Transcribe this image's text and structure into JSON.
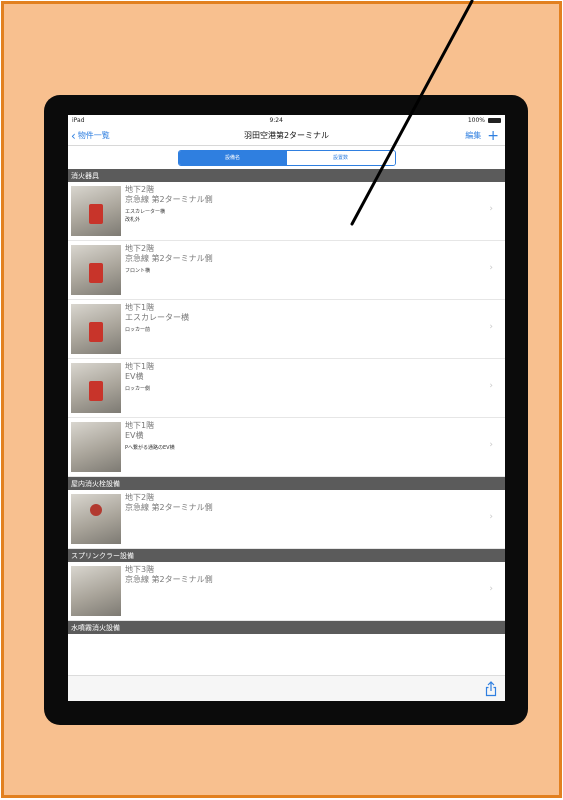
{
  "status_bar": {
    "carrier": "iPad",
    "time": "9:24",
    "battery": "100%"
  },
  "nav": {
    "back_label": "物件一覧",
    "title": "羽田空港第2ターミナル",
    "edit_label": "編集",
    "add_label": "+"
  },
  "segment": {
    "options": [
      "設備名",
      "設置数"
    ],
    "selected": "設備名"
  },
  "sections": [
    {
      "title": "消火器具",
      "rows": [
        {
          "floor": "地下2階",
          "location": "京急線 第2ターミナル側",
          "note1": "エスカレーター横",
          "note2": "改札外",
          "thumb": "red"
        },
        {
          "floor": "地下2階",
          "location": "京急線 第2ターミナル側",
          "note1": "フロント横",
          "note2": "",
          "thumb": "red"
        },
        {
          "floor": "地下1階",
          "location": "エスカレーター横",
          "note1": "ロッカー前",
          "note2": "",
          "thumb": "red"
        },
        {
          "floor": "地下1階",
          "location": "EV横",
          "note1": "ロッカー側",
          "note2": "",
          "thumb": "red"
        },
        {
          "floor": "地下1階",
          "location": "EV横",
          "note1": "Pへ繋がる通路のEV横",
          "note2": "",
          "thumb": "none"
        }
      ]
    },
    {
      "title": "屋内消火栓設備",
      "rows": [
        {
          "floor": "地下2階",
          "location": "京急線 第2ターミナル側",
          "note1": "",
          "note2": "",
          "thumb": "pale"
        }
      ]
    },
    {
      "title": "スプリンクラー設備",
      "rows": [
        {
          "floor": "地下3階",
          "location": "京急線 第2ターミナル側",
          "note1": "",
          "note2": "",
          "thumb": "none"
        }
      ]
    },
    {
      "title": "水噴霧消火設備",
      "rows": []
    }
  ],
  "icons": {
    "back": "chevron-left-icon",
    "row_chevron": "chevron-right-icon",
    "share": "share-icon",
    "wifi": "wifi-icon",
    "battery": "battery-icon"
  },
  "colors": {
    "accent": "#2f7fe0",
    "section_header": "#5b5b5b",
    "frame_bg": "#f8c08f",
    "frame_border": "#e2801f",
    "annotation_arrow": "#000000"
  }
}
